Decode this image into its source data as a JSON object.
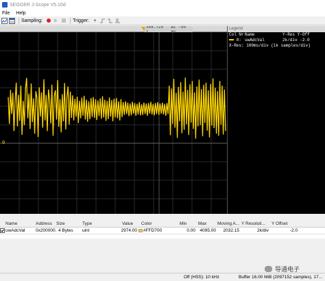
{
  "window": {
    "title": "SEGGER J-Scope V5.10d"
  },
  "menu": [
    "File",
    "Help"
  ],
  "toolbar": {
    "sampling_label": "Sampling:",
    "trigger_label": "Trigger:",
    "trigger_dropdown": "▾",
    "samples": [
      {
        "icon": "record-icon"
      },
      {
        "icon": "play-icon"
      },
      {
        "icon": "stop-icon"
      }
    ]
  },
  "scope": {
    "cursor_time": "358.729 s",
    "cursor_delta": "Δt -50 ms",
    "zero_marker": "0",
    "trace_color": "#ffd700",
    "trace": [
      0.28,
      -0.35,
      0.45,
      -0.12,
      0.38,
      -0.52,
      0.21,
      0.62,
      -0.41,
      0.33,
      -0.28,
      0.55,
      -0.61,
      0.19,
      -0.38,
      0.48,
      0.73,
      -0.22,
      0.36,
      -0.47,
      0.6,
      -0.31,
      0.25,
      -0.58,
      0.42,
      0.27,
      -0.66,
      0.51,
      -0.18,
      0.39,
      -0.44,
      0.7,
      -0.27,
      0.33,
      -0.52,
      0.46,
      0.21,
      -0.34,
      0.57,
      -0.63,
      0.31,
      0.44,
      -0.25,
      0.68,
      -0.42,
      0.23,
      -0.55,
      0.35,
      -0.29,
      0.61,
      -0.48,
      0.26,
      0.53,
      -0.37,
      0.41,
      -0.21,
      0.32,
      -0.27,
      0.24,
      -0.18,
      0.29,
      -0.33,
      0.19,
      -0.22,
      0.27,
      -0.16,
      0.31,
      -0.25,
      0.22,
      -0.3,
      0.18,
      -0.24,
      0.26,
      -0.19,
      0.28,
      -0.21,
      0.23,
      -0.26,
      0.2,
      -0.17,
      0.25,
      -0.23,
      0.3,
      -0.2,
      0.22,
      -0.28,
      0.19,
      -0.24,
      0.27,
      -0.18,
      0.21,
      -0.29,
      0.24,
      -0.2,
      0.26,
      -0.22,
      0.18,
      -0.27,
      0.23,
      -0.19,
      0.16,
      -0.14,
      0.18,
      -0.12,
      0.15,
      -0.17,
      0.13,
      -0.15,
      0.17,
      -0.11,
      0.14,
      -0.16,
      0.12,
      -0.13,
      0.16,
      -0.15,
      0.11,
      -0.14,
      0.15,
      -0.12,
      0.13,
      -0.16,
      0.14,
      -0.11,
      0.17,
      -0.13,
      0.12,
      -0.15,
      0.14,
      -0.12,
      0.16,
      -0.14,
      0.13,
      -0.11,
      0.15,
      -0.13,
      0.12,
      -0.16,
      0.14,
      -0.12,
      0.55,
      -0.62,
      0.48,
      -0.35,
      0.71,
      -0.44,
      0.38,
      -0.68,
      0.52,
      -0.29,
      0.63,
      -0.57,
      0.41,
      -0.49,
      0.74,
      -0.36,
      0.45,
      -0.61,
      0.58,
      -0.32,
      0.66,
      -0.47,
      0.39,
      -0.7,
      0.53,
      -0.41,
      0.69,
      -0.38,
      0.47,
      -0.64,
      0.57,
      -0.33,
      0.62,
      -0.51,
      0.44,
      -0.67,
      0.59,
      -0.39,
      0.72,
      -0.45,
      0.5,
      -0.58,
      0.42,
      -0.63,
      0.66,
      -0.37,
      0.55,
      -0.6,
      0.46,
      -0.52
    ]
  },
  "legend": {
    "title": "Legend",
    "header": {
      "col": "Col",
      "nr": "Nr",
      "name": "Name",
      "yres": "Y-Res",
      "yoff": "Y-Off"
    },
    "channel": {
      "nr": "0:",
      "name": "uwAdcVal",
      "yres": "2k/div",
      "yoff": "-2.0"
    },
    "xres": "X-Res: 100ms/div (1k samples/div)"
  },
  "table": {
    "columns": [
      "Name",
      "Address",
      "Size",
      "Type",
      "Value",
      "Color",
      "Min",
      "Max",
      "Moving A...",
      "Y Resoluti...",
      "Y Offset"
    ],
    "rows": [
      {
        "checked": true,
        "name": "uwAdcVal",
        "address": "0x200000...",
        "size": "4 Bytes",
        "type": "uint",
        "value": "2974.00",
        "color": "#FFD700",
        "min": "0.00",
        "max": "4095.00",
        "moving_avg": "2032.15",
        "y_res": "2k/div",
        "y_offset": "-2.0"
      }
    ]
  },
  "watermark": {
    "text": "导通电子"
  },
  "status": {
    "hss": "Off (HSS): 10 kHz",
    "buffer": "Buffer 16.00 MiB (2097152 samples), 17..."
  }
}
